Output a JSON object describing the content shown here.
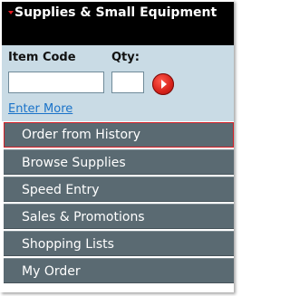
{
  "header": {
    "title": "Supplies & Small Equipment"
  },
  "quick_order": {
    "item_code_label": "Item Code",
    "qty_label": "Qty:",
    "item_code_value": "",
    "qty_value": "",
    "go_icon": "arrow-right-circle-icon",
    "enter_more_label": "Enter More"
  },
  "menu": {
    "items": [
      {
        "label": "Order from History"
      },
      {
        "label": "Browse Supplies"
      },
      {
        "label": "Speed Entry"
      },
      {
        "label": "Sales & Promotions"
      },
      {
        "label": "Shopping Lists"
      },
      {
        "label": "My Order"
      }
    ],
    "active_index": 0
  },
  "colors": {
    "header_bg": "#000000",
    "accent_red": "#d31f26",
    "quick_bg": "#c9dbe5",
    "menu_bg": "#5a6a72",
    "link": "#1a73c9"
  }
}
